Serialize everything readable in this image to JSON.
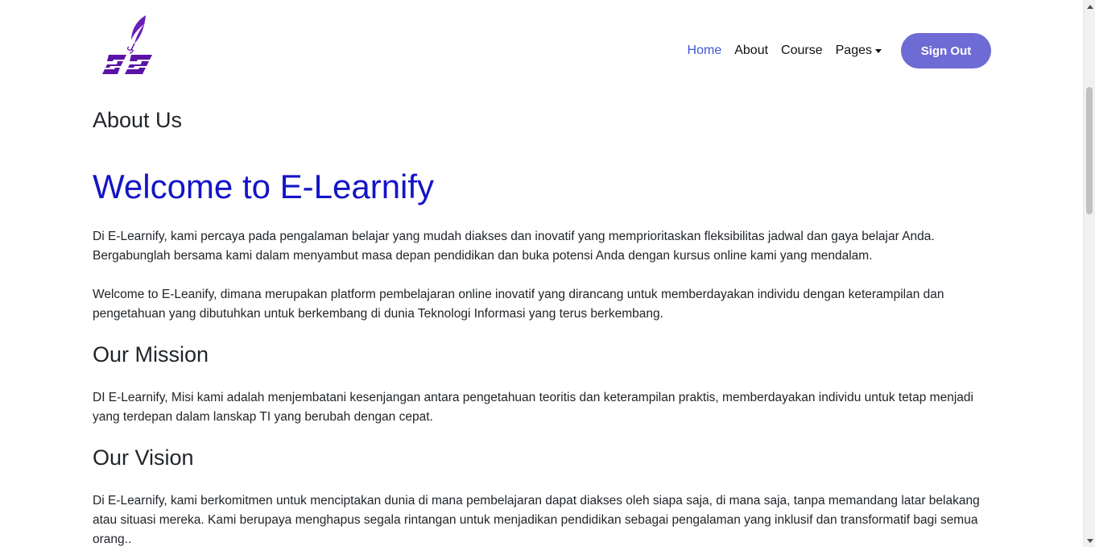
{
  "navbar": {
    "logo_icon": "quill-feather-logo-icon",
    "links": [
      {
        "label": "Home",
        "active": true
      },
      {
        "label": "About",
        "active": false
      },
      {
        "label": "Course",
        "active": false
      },
      {
        "label": "Pages",
        "active": false,
        "dropdown": true
      }
    ],
    "signout_label": "Sign Out"
  },
  "main": {
    "page_title": "About Us",
    "welcome_heading": "Welcome to E-Learnify",
    "intro_paragraph_1": "Di E-Learnify, kami percaya pada pengalaman belajar yang mudah diakses dan inovatif yang memprioritaskan fleksibilitas jadwal dan gaya belajar Anda. Bergabunglah bersama kami dalam menyambut masa depan pendidikan dan buka potensi Anda dengan kursus online kami yang mendalam.",
    "intro_paragraph_2": "Welcome to E-Leanify, dimana merupakan platform pembelajaran online inovatif yang dirancang untuk memberdayakan individu dengan keterampilan dan pengetahuan yang dibutuhkan untuk berkembang di dunia Teknologi Informasi yang terus berkembang.",
    "mission": {
      "heading": "Our Mission",
      "text": "DI E-Learnify, Misi kami adalah menjembatani kesenjangan antara pengetahuan teoritis dan keterampilan praktis, memberdayakan individu untuk tetap menjadi yang terdepan dalam lanskap TI yang berubah dengan cepat."
    },
    "vision": {
      "heading": "Our Vision",
      "text": "Di E-Learnify, kami berkomitmen untuk menciptakan dunia di mana pembelajaran dapat diakses oleh siapa saja, di mana saja, tanpa memandang latar belakang atau situasi mereka. Kami berupaya menghapus segala rintangan untuk menjadikan pendidikan sebagai pengalaman yang inklusif dan transformatif bagi semua orang.."
    }
  },
  "colors": {
    "brand_purple": "#6f6bd4",
    "logo_purple": "#5b12a6",
    "active_link": "#3e56d6",
    "welcome_heading": "#1414c8"
  }
}
